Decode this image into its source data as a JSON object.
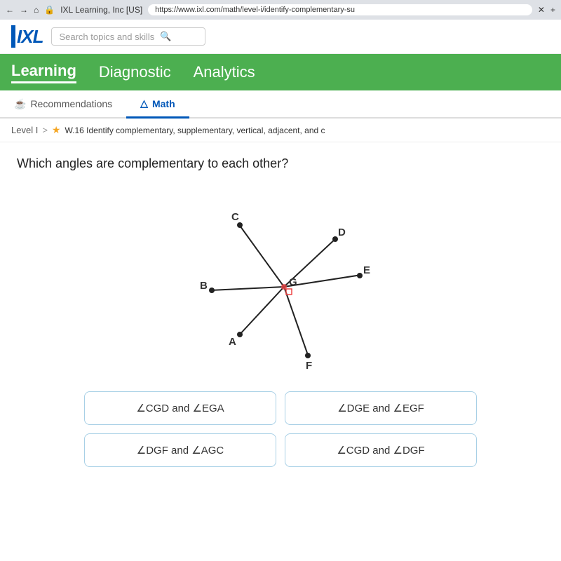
{
  "browser": {
    "tab_label": "IXL Learning, Inc [US]",
    "url": "https://www.ixl.com/math/level-i/identify-complementary-su",
    "lock_icon": "🔒"
  },
  "header": {
    "logo": "IXL",
    "search_placeholder": "Search topics and skills"
  },
  "nav": {
    "items": [
      {
        "label": "Learning",
        "active": true
      },
      {
        "label": "Diagnostic",
        "active": false
      },
      {
        "label": "Analytics",
        "active": false
      }
    ]
  },
  "sub_nav": {
    "items": [
      {
        "label": "Recommendations",
        "icon": "☕",
        "active": false
      },
      {
        "label": "Math",
        "icon": "△",
        "active": true
      }
    ]
  },
  "breadcrumb": {
    "level": "Level I",
    "separator": ">",
    "star": "★",
    "lesson": "W.16 Identify complementary, supplementary, vertical, adjacent, and c"
  },
  "question": {
    "text": "Which angles are complementary to each other?"
  },
  "answers": [
    {
      "id": "a1",
      "text": "∠CGD and ∠EGA"
    },
    {
      "id": "a2",
      "text": "∠DGE and ∠EGF"
    },
    {
      "id": "a3",
      "text": "∠DGF and ∠AGC"
    },
    {
      "id": "a4",
      "text": "∠CGD and ∠DGF"
    }
  ],
  "colors": {
    "green": "#4caf50",
    "blue": "#0057b8",
    "light_blue_border": "#a8d0e6"
  },
  "diagram": {
    "center_label": "G",
    "point_labels": [
      "C",
      "D",
      "E",
      "B",
      "A",
      "F"
    ],
    "right_angle_indicator": true
  }
}
